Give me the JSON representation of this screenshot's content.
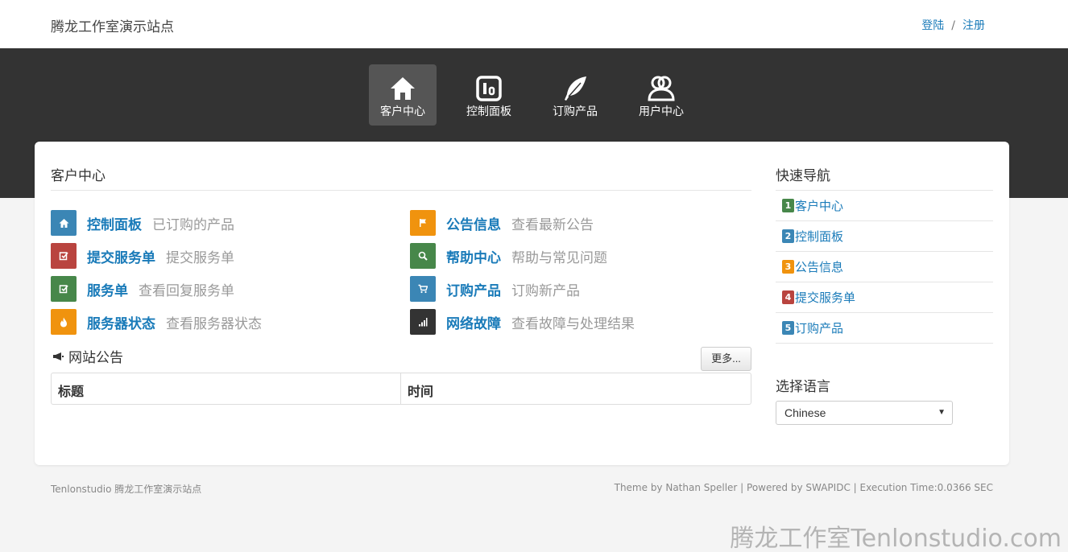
{
  "header": {
    "site_title": "腾龙工作室演示站点",
    "login": "登陆",
    "separator": "/",
    "register": "注册"
  },
  "nav": {
    "items": [
      {
        "label": "客户中心",
        "icon": "home-icon",
        "active": true
      },
      {
        "label": "控制面板",
        "icon": "dashboard-icon",
        "active": false
      },
      {
        "label": "订购产品",
        "icon": "feather-icon",
        "active": false
      },
      {
        "label": "用户中心",
        "icon": "users-icon",
        "active": false
      }
    ]
  },
  "main": {
    "section_title": "客户中心",
    "links": [
      {
        "title": "控制面板",
        "desc": "已订购的产品",
        "icon": "home-icon",
        "color": "#3b86b5"
      },
      {
        "title": "公告信息",
        "desc": "查看最新公告",
        "icon": "flag-icon",
        "color": "#f0930e"
      },
      {
        "title": "提交服务单",
        "desc": "提交服务单",
        "icon": "edit-icon",
        "color": "#b9443f"
      },
      {
        "title": "帮助中心",
        "desc": "帮助与常见问题",
        "icon": "search-icon",
        "color": "#47874a"
      },
      {
        "title": "服务单",
        "desc": "查看回复服务单",
        "icon": "check-icon",
        "color": "#47874a"
      },
      {
        "title": "订购产品",
        "desc": "订购新产品",
        "icon": "cart-icon",
        "color": "#3b86b5"
      },
      {
        "title": "服务器状态",
        "desc": "查看服务器状态",
        "icon": "fire-icon",
        "color": "#f0930e"
      },
      {
        "title": "网络故障",
        "desc": "查看故障与处理结果",
        "icon": "signal-icon",
        "color": "#333333"
      }
    ],
    "notice": {
      "title": "网站公告",
      "more_button": "更多...",
      "columns": [
        "标题",
        "时间"
      ]
    }
  },
  "sidebar": {
    "title": "快速导航",
    "items": [
      {
        "num": "1",
        "label": "客户中心",
        "color": "#47874a"
      },
      {
        "num": "2",
        "label": "控制面板",
        "color": "#3b86b5"
      },
      {
        "num": "3",
        "label": "公告信息",
        "color": "#f0930e"
      },
      {
        "num": "4",
        "label": "提交服务单",
        "color": "#b9443f"
      },
      {
        "num": "5",
        "label": "订购产品",
        "color": "#3b86b5"
      }
    ],
    "language_title": "选择语言",
    "language_selected": "Chinese"
  },
  "footer": {
    "left": "Tenlonstudio 腾龙工作室演示站点",
    "right": "Theme by Nathan Speller | Powered by SWAPIDC | Execution Time:0.0366 SEC"
  },
  "watermark": "腾龙工作室Tenlonstudio.com"
}
